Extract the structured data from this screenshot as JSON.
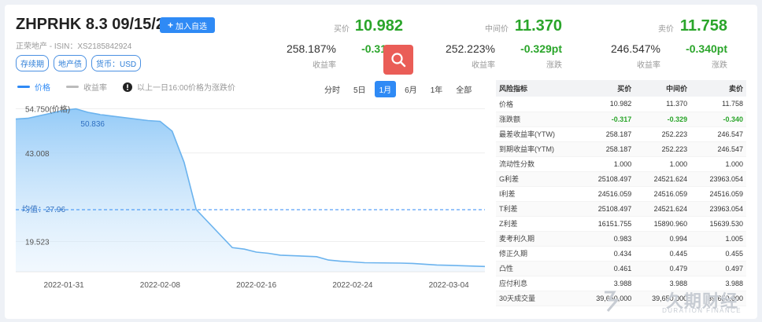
{
  "header": {
    "ticker": "ZHPRHK 8.3 09/15/23",
    "watch_label": "加入自选",
    "sub": "正荣地产 - ISIN：XS2185842924",
    "tags": [
      "存续期",
      "地产债",
      "货币：USD"
    ]
  },
  "quotes": {
    "bid": {
      "label": "买价",
      "price": "10.982",
      "yield": "258.187%",
      "yield_label": "收益率",
      "change": "-0.317pt",
      "change_label": "涨跌"
    },
    "mid": {
      "label": "中间价",
      "price": "11.370",
      "yield": "252.223%",
      "yield_label": "收益率",
      "change": "-0.329pt",
      "change_label": "涨跌"
    },
    "ask": {
      "label": "卖价",
      "price": "11.758",
      "yield": "246.547%",
      "yield_label": "收益率",
      "change": "-0.340pt",
      "change_label": "涨跌"
    }
  },
  "legend": {
    "price": "价格",
    "yield": "收益率",
    "note": "以上一日16:00价格为涨跌价"
  },
  "ranges": [
    "分时",
    "5日",
    "1月",
    "6月",
    "1年",
    "全部"
  ],
  "active_range": "1月",
  "colors": {
    "accent": "#2f8af5",
    "up": "#2aa52a",
    "search": "#ea5d57"
  },
  "chart_data": {
    "type": "area",
    "series": [
      {
        "name": "价格",
        "x": [
          "2022-01-27",
          "2022-01-28",
          "2022-01-31",
          "2022-02-01",
          "2022-02-02",
          "2022-02-03",
          "2022-02-04",
          "2022-02-07",
          "2022-02-08",
          "2022-02-09",
          "2022-02-10",
          "2022-02-11",
          "2022-02-14",
          "2022-02-15",
          "2022-02-16",
          "2022-02-17",
          "2022-02-18",
          "2022-02-21",
          "2022-02-22",
          "2022-02-23",
          "2022-02-24",
          "2022-02-25",
          "2022-02-28",
          "2022-03-01",
          "2022-03-02",
          "2022-03-03",
          "2022-03-04",
          "2022-03-07"
        ],
        "y": [
          52.0,
          52.2,
          54.3,
          54.7,
          53.8,
          53.2,
          52.8,
          51.6,
          51.4,
          48.8,
          40.5,
          28.0,
          17.9,
          17.5,
          16.7,
          16.4,
          15.9,
          15.5,
          14.6,
          14.3,
          14.1,
          13.9,
          13.8,
          13.7,
          13.5,
          13.3,
          13.2,
          12.9
        ]
      }
    ],
    "y_labels": [
      "54.750(价格)",
      "43.008",
      "19.523"
    ],
    "y_ticks": [
      54.75,
      43.008,
      19.523
    ],
    "ylim": [
      11.5,
      56.5
    ],
    "x_ticks": [
      "2022-01-31",
      "2022-02-08",
      "2022-02-16",
      "2022-02-24",
      "2022-03-04"
    ],
    "max_label": "50.836",
    "max_value": 50.836,
    "avg_label": "均值：27.96",
    "avg_value": 27.96,
    "grid": "horizontal"
  },
  "risk_table": {
    "headers": [
      "风险指标",
      "买价",
      "中间价",
      "卖价"
    ],
    "rows": [
      [
        "价格",
        "10.982",
        "11.370",
        "11.758"
      ],
      [
        "涨跌额",
        "-0.317",
        "-0.329",
        "-0.340"
      ],
      [
        "最差收益率(YTW)",
        "258.187",
        "252.223",
        "246.547"
      ],
      [
        "到期收益率(YTM)",
        "258.187",
        "252.223",
        "246.547"
      ],
      [
        "流动性分数",
        "1.000",
        "1.000",
        "1.000"
      ],
      [
        "G利差",
        "25108.497",
        "24521.624",
        "23963.054"
      ],
      [
        "I利差",
        "24516.059",
        "24516.059",
        "24516.059"
      ],
      [
        "T利差",
        "25108.497",
        "24521.624",
        "23963.054"
      ],
      [
        "Z利差",
        "16151.755",
        "15890.960",
        "15639.530"
      ],
      [
        "麦考利久期",
        "0.983",
        "0.994",
        "1.005"
      ],
      [
        "修正久期",
        "0.434",
        "0.445",
        "0.455"
      ],
      [
        "凸性",
        "0.461",
        "0.479",
        "0.497"
      ],
      [
        "应付利息",
        "3.988",
        "3.988",
        "3.988"
      ],
      [
        "30天成交量",
        "39,650,000",
        "39,650,000",
        "39,650,000"
      ]
    ]
  },
  "brand": {
    "cn": "久期财经",
    "en": "DURATION FINANCE"
  }
}
